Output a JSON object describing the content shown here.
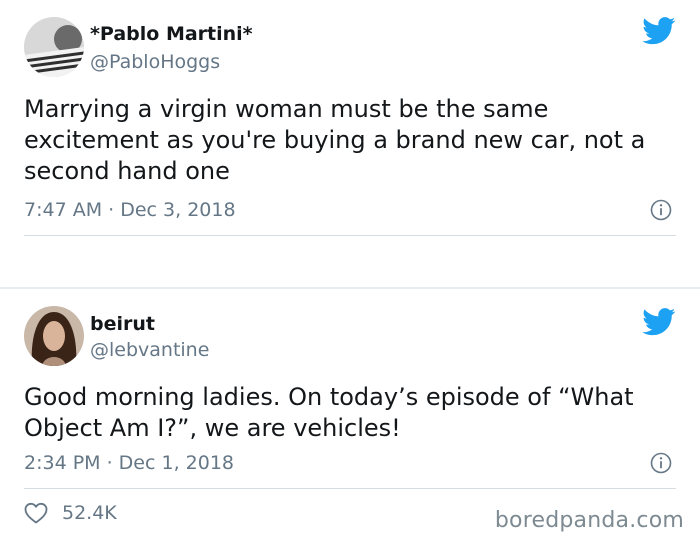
{
  "tweets": [
    {
      "display_name": "*Pablo Martini*",
      "handle": "@PabloHoggs",
      "text": "Marrying a virgin woman must be the same excitement as you're buying a brand new car, not a second hand one",
      "timestamp": "7:47 AM · Dec 3, 2018",
      "icons": {
        "avatar": "avatar-photo",
        "brand": "twitter-bird-icon",
        "info": "info-icon"
      }
    },
    {
      "display_name": "beirut",
      "handle": "@lebvantine",
      "text": "Good morning ladies. On today’s episode of “What Object Am I?”, we are vehicles!",
      "timestamp": "2:34 PM · Dec 1, 2018",
      "likes": "52.4K",
      "icons": {
        "avatar": "avatar-photo",
        "brand": "twitter-bird-icon",
        "info": "info-icon",
        "like": "heart-icon"
      }
    }
  ],
  "watermark": "boredpanda.com",
  "colors": {
    "brand": "#1da1f2",
    "text_primary": "#14171a",
    "text_secondary": "#657786",
    "divider": "#e6ecf0"
  }
}
